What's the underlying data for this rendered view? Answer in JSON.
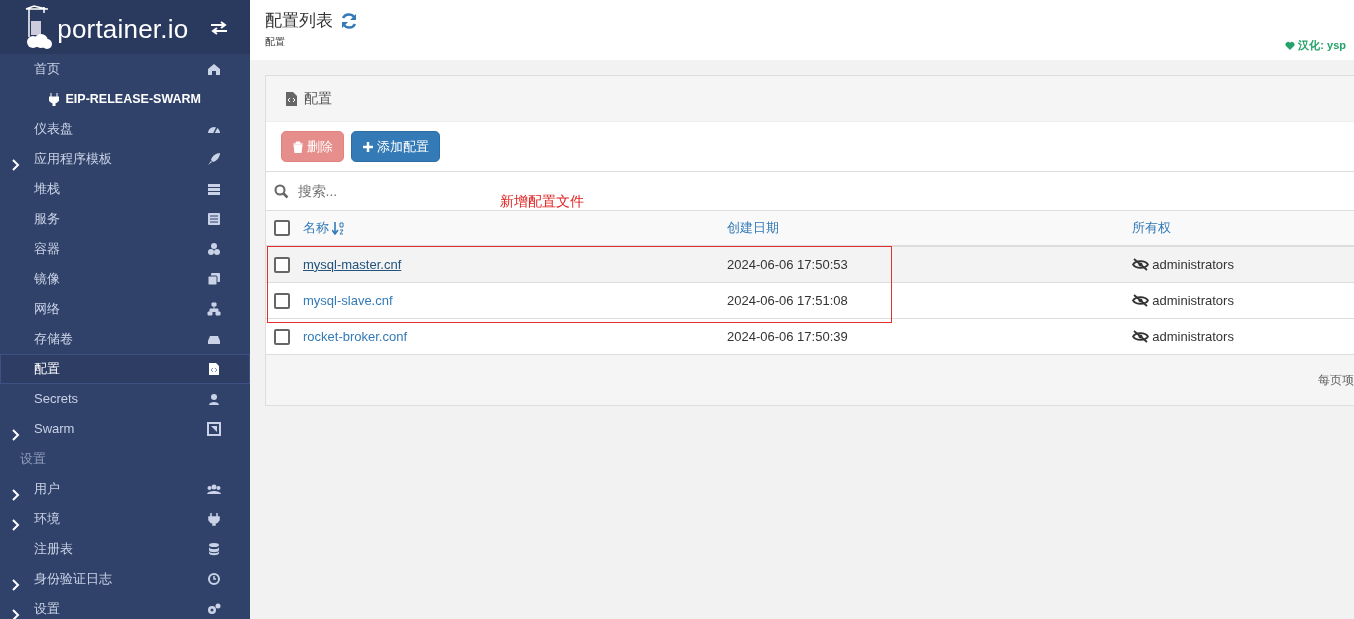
{
  "sidebar": {
    "logo": "portainer.io",
    "items": [
      {
        "kind": "item",
        "label": "首页",
        "expandable": false,
        "selected": false
      },
      {
        "kind": "endpoint",
        "label": "EIP-RELEASE-SWARM"
      },
      {
        "kind": "item",
        "label": "仪表盘",
        "expandable": false,
        "selected": false
      },
      {
        "kind": "item",
        "label": "应用程序模板",
        "expandable": true,
        "selected": false
      },
      {
        "kind": "item",
        "label": "堆栈",
        "expandable": false,
        "selected": false
      },
      {
        "kind": "item",
        "label": "服务",
        "expandable": false,
        "selected": false
      },
      {
        "kind": "item",
        "label": "容器",
        "expandable": false,
        "selected": false
      },
      {
        "kind": "item",
        "label": "镜像",
        "expandable": false,
        "selected": false
      },
      {
        "kind": "item",
        "label": "网络",
        "expandable": false,
        "selected": false
      },
      {
        "kind": "item",
        "label": "存储卷",
        "expandable": false,
        "selected": false
      },
      {
        "kind": "item",
        "label": "配置",
        "expandable": false,
        "selected": true
      },
      {
        "kind": "item",
        "label": "Secrets",
        "expandable": false,
        "selected": false
      },
      {
        "kind": "item",
        "label": "Swarm",
        "expandable": true,
        "selected": false
      },
      {
        "kind": "heading",
        "label": "设置"
      },
      {
        "kind": "item",
        "label": "用户",
        "expandable": true,
        "selected": false
      },
      {
        "kind": "item",
        "label": "环境",
        "expandable": true,
        "selected": false
      },
      {
        "kind": "item",
        "label": "注册表",
        "expandable": false,
        "selected": false
      },
      {
        "kind": "item",
        "label": "身份验证日志",
        "expandable": true,
        "selected": false
      },
      {
        "kind": "item",
        "label": "设置",
        "expandable": true,
        "selected": false
      }
    ]
  },
  "header": {
    "title": "配置列表",
    "breadcrumb": "配置",
    "credit": "汉化: ysp"
  },
  "panel": {
    "title": "配置",
    "buttons": [
      {
        "label": "删除",
        "disabled": true
      },
      {
        "label": "添加配置",
        "disabled": false
      }
    ],
    "search": {
      "placeholder": "搜索..."
    },
    "select_all": {
      "checked": false
    },
    "annotation": "新增配置文件",
    "table": {
      "columns": [
        "名称",
        "创建日期",
        "所有权"
      ],
      "rows": [
        {
          "name": "mysql-master.cnf",
          "created": "2024-06-06 17:50:53",
          "ownership": "administrators",
          "checked": false,
          "hovered": true
        },
        {
          "name": "mysql-slave.cnf",
          "created": "2024-06-06 17:51:08",
          "ownership": "administrators",
          "checked": false,
          "hovered": false
        },
        {
          "name": "rocket-broker.conf",
          "created": "2024-06-06 17:50:39",
          "ownership": "administrators",
          "checked": false,
          "hovered": false
        }
      ]
    },
    "footer": "每页项"
  }
}
